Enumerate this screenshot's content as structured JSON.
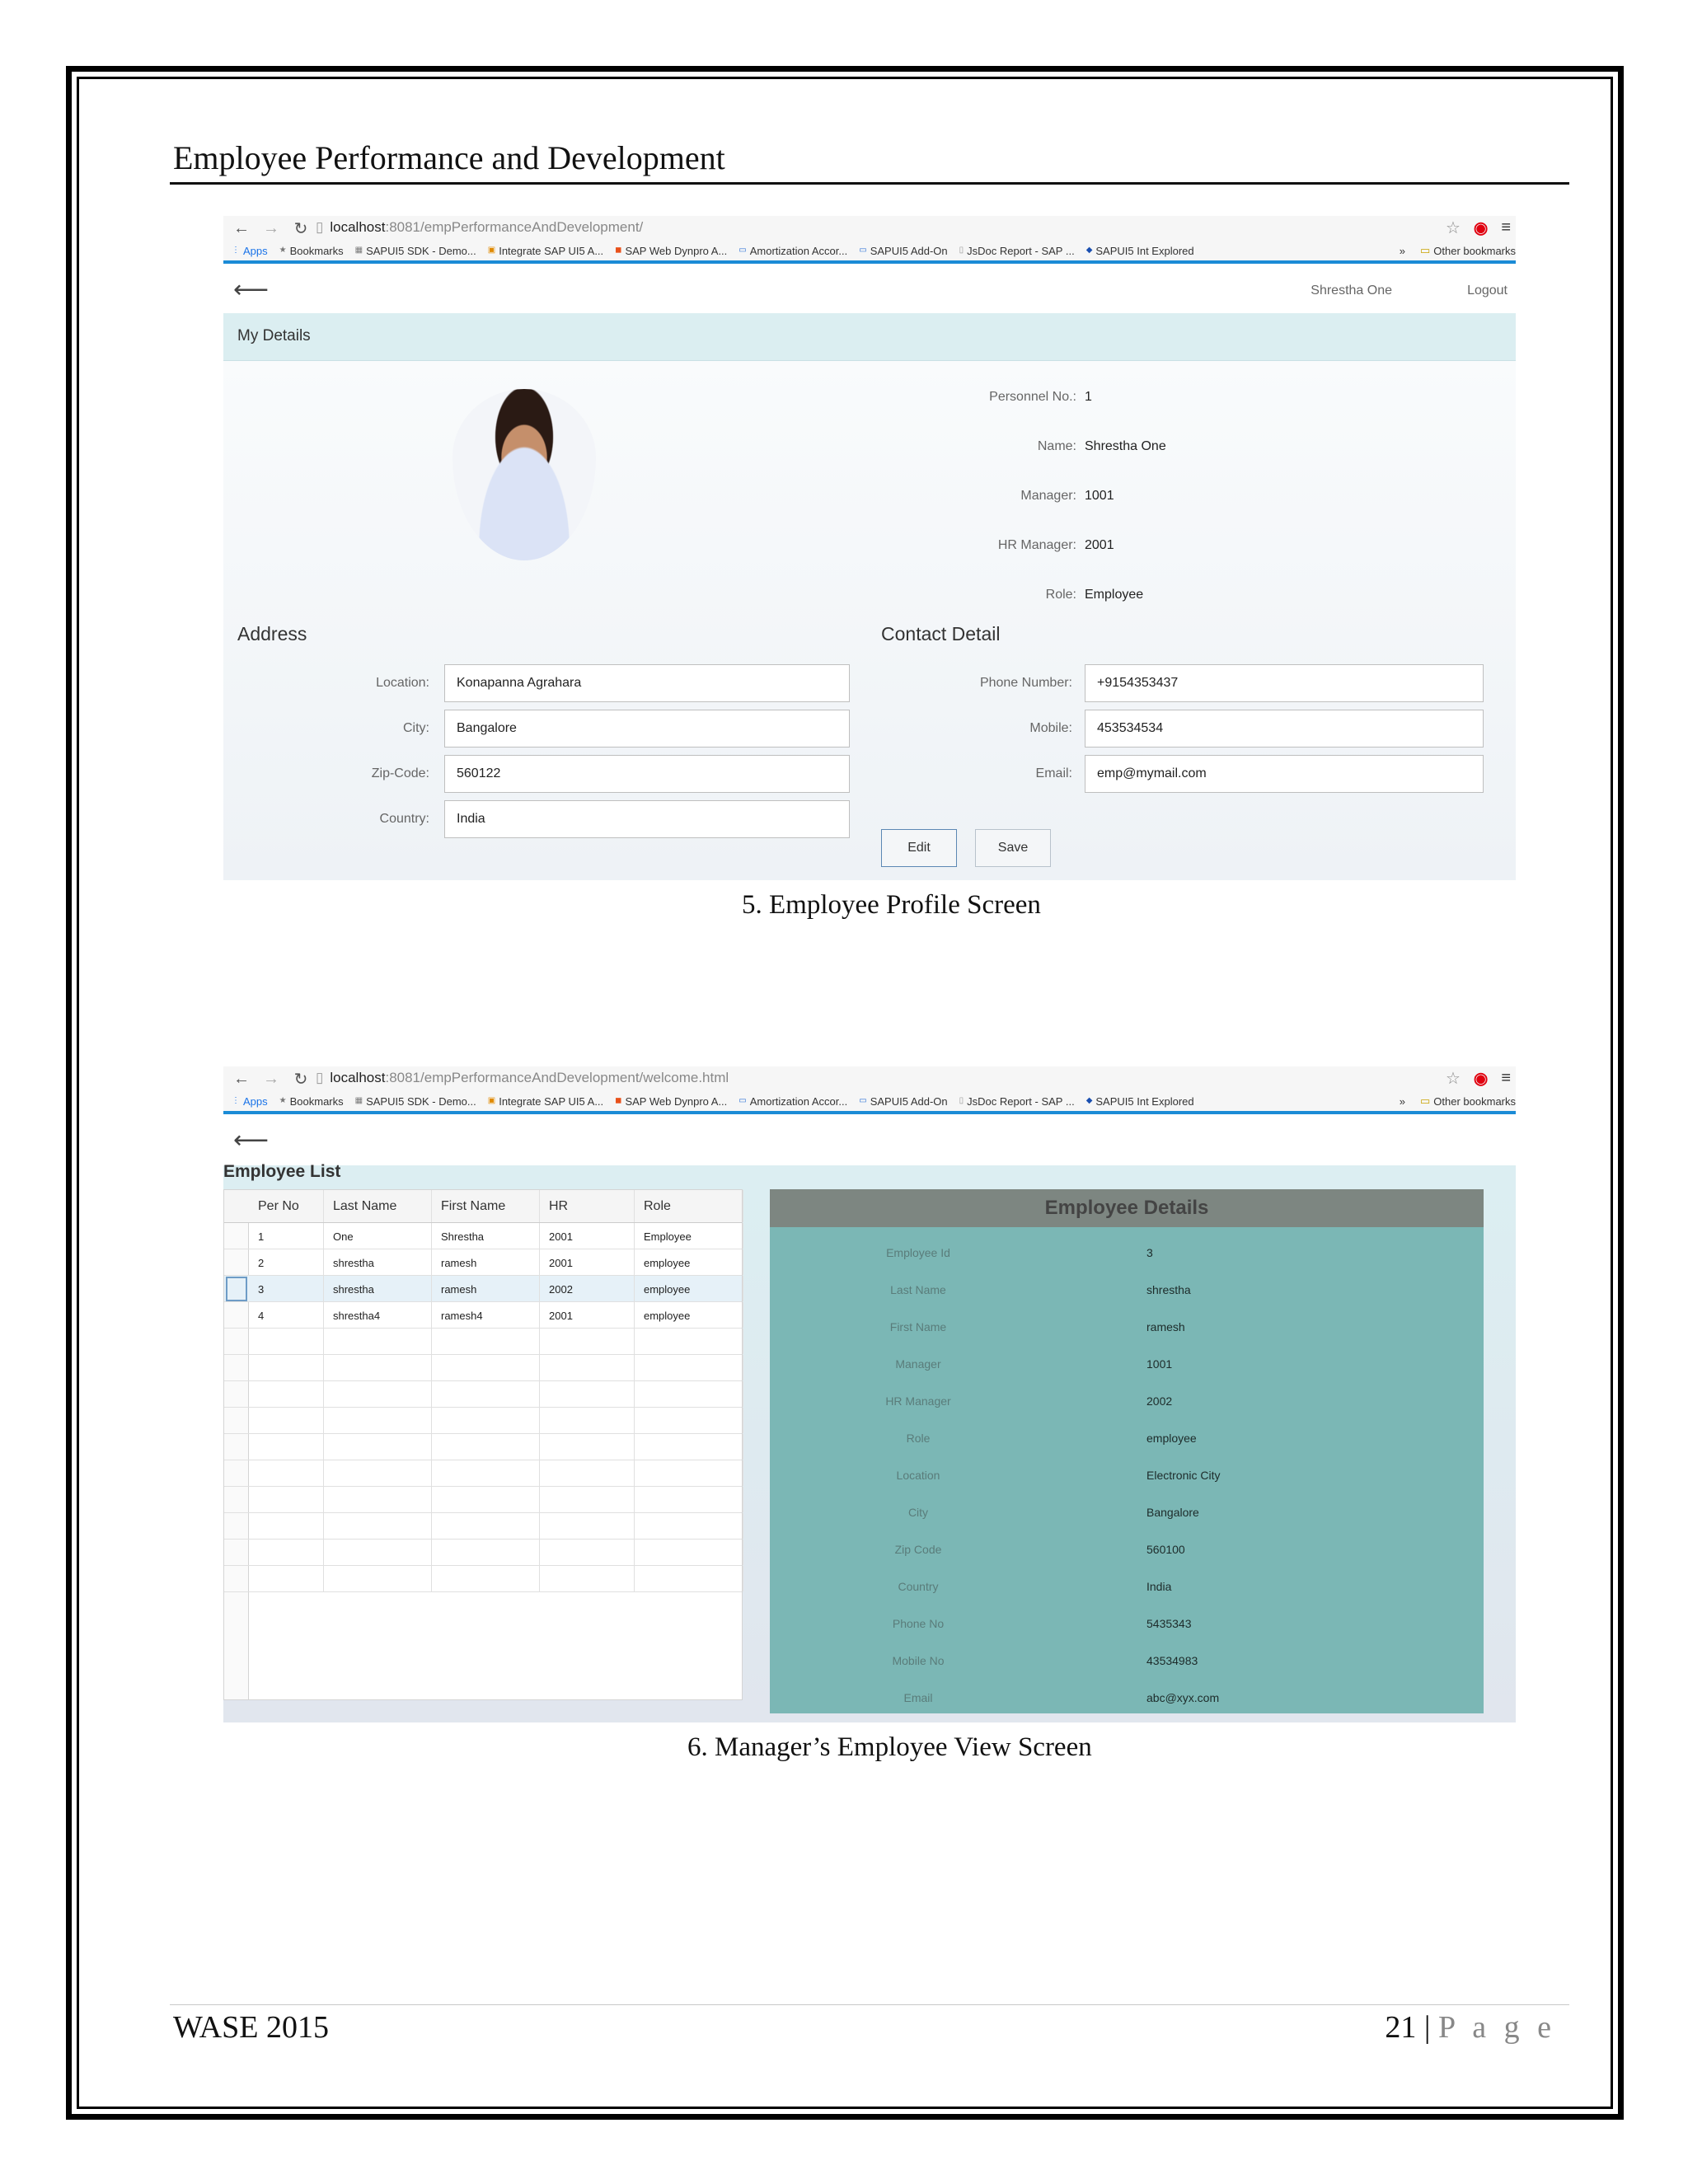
{
  "doc": {
    "header": "Employee Performance and Development",
    "footer_left": "WASE 2015",
    "page_number": "21",
    "page_sep": "|",
    "page_word": "P a g e"
  },
  "browser1": {
    "url_host": "localhost",
    "url_path": ":8081/empPerformanceAndDevelopment/",
    "bookmarks": [
      "Apps",
      "Bookmarks",
      "SAPUI5 SDK - Demo...",
      "Integrate SAP UI5 A...",
      "SAP Web Dynpro A...",
      "Amortization Accor...",
      "SAPUI5 Add-On",
      "JsDoc Report - SAP ...",
      "SAPUI5 Int Explored"
    ],
    "more": "»",
    "other": "Other bookmarks"
  },
  "browser2": {
    "url_host": "localhost",
    "url_path": ":8081/empPerformanceAndDevelopment/welcome.html",
    "bookmarks": [
      "Apps",
      "Bookmarks",
      "SAPUI5 SDK - Demo...",
      "Integrate SAP UI5 A...",
      "SAP Web Dynpro A...",
      "Amortization Accor...",
      "SAPUI5 Add-On",
      "JsDoc Report - SAP ...",
      "SAPUI5 Int Explored"
    ],
    "more": "»",
    "other": "Other bookmarks"
  },
  "profile": {
    "user": "Shrestha One",
    "logout": "Logout",
    "panel_title": "My Details",
    "info": [
      {
        "label": "Personnel No.:",
        "value": "1"
      },
      {
        "label": "Name:",
        "value": "Shrestha One"
      },
      {
        "label": "Manager:",
        "value": "1001"
      },
      {
        "label": "HR Manager:",
        "value": "2001"
      },
      {
        "label": "Role:",
        "value": "Employee"
      }
    ],
    "address_title": "Address",
    "address": [
      {
        "label": "Location:",
        "value": "Konapanna Agrahara"
      },
      {
        "label": "City:",
        "value": "Bangalore"
      },
      {
        "label": "Zip-Code:",
        "value": "560122"
      },
      {
        "label": "Country:",
        "value": "India"
      }
    ],
    "contact_title": "Contact Detail",
    "contact": [
      {
        "label": "Phone Number:",
        "value": "+9154353437"
      },
      {
        "label": "Mobile:",
        "value": "453534534"
      },
      {
        "label": "Email:",
        "value": "emp@mymail.com"
      }
    ],
    "edit_label": "Edit",
    "save_label": "Save"
  },
  "caption1": "5. Employee Profile Screen",
  "manager": {
    "list_title": "Employee List",
    "columns": [
      "Per No",
      "Last Name",
      "First Name",
      "HR",
      "Role"
    ],
    "rows": [
      [
        "1",
        "One",
        "Shrestha",
        "2001",
        "Employee"
      ],
      [
        "2",
        "shrestha",
        "ramesh",
        "2001",
        "employee"
      ],
      [
        "3",
        "shrestha",
        "ramesh",
        "2002",
        "employee"
      ],
      [
        "4",
        "shrestha4",
        "ramesh4",
        "2001",
        "employee"
      ]
    ],
    "selected_row": 2,
    "details_title": "Employee Details",
    "details": [
      {
        "label": "Employee Id",
        "value": "3"
      },
      {
        "label": "Last Name",
        "value": "shrestha"
      },
      {
        "label": "First Name",
        "value": "ramesh"
      },
      {
        "label": "Manager",
        "value": "1001"
      },
      {
        "label": "HR Manager",
        "value": "2002"
      },
      {
        "label": "Role",
        "value": "employee"
      },
      {
        "label": "Location",
        "value": "Electronic City"
      },
      {
        "label": "City",
        "value": "Bangalore"
      },
      {
        "label": "Zip Code",
        "value": "560100"
      },
      {
        "label": "Country",
        "value": "India"
      },
      {
        "label": "Phone No",
        "value": "5435343"
      },
      {
        "label": "Mobile No",
        "value": "43534983"
      },
      {
        "label": "Email",
        "value": "abc@xyx.com"
      }
    ]
  },
  "caption2": "6. Manager’s Employee View Screen"
}
